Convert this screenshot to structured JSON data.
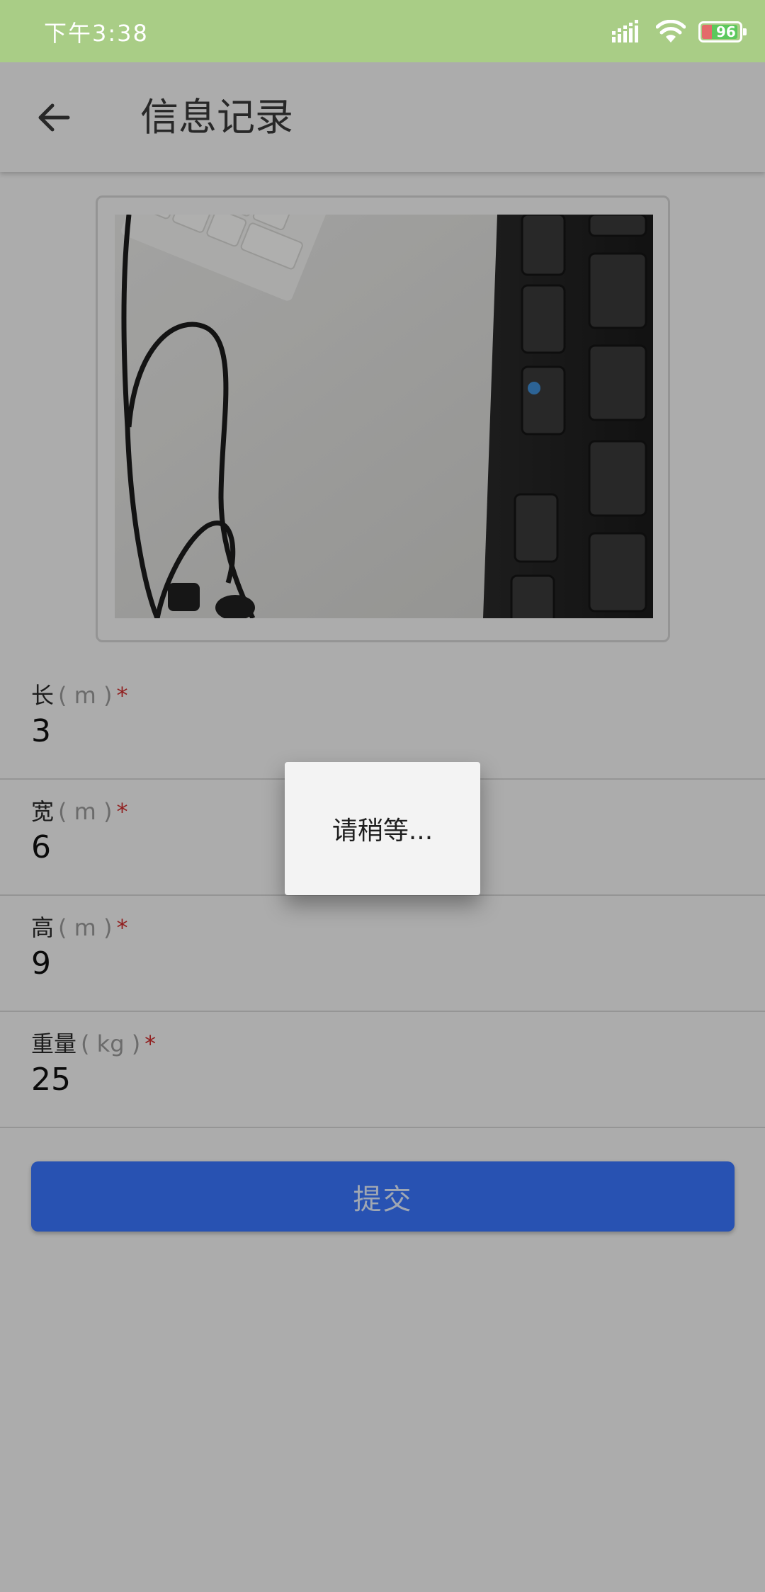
{
  "status_bar": {
    "time": "下午3:38",
    "signal_icon": "signal-icon",
    "wifi_icon": "wifi-icon",
    "battery_level": "96",
    "battery_fraction": 0.96,
    "color": "#a9cd86"
  },
  "app_bar": {
    "back_icon": "arrow-left-icon",
    "title": "信息记录"
  },
  "photo": {
    "content": "photo-thumbnail"
  },
  "form": {
    "fields": [
      {
        "label": "长",
        "unit": "( m )",
        "required": "*",
        "value": "3"
      },
      {
        "label": "宽",
        "unit": "( m )",
        "required": "*",
        "value": "6"
      },
      {
        "label": "高",
        "unit": "( m )",
        "required": "*",
        "value": "9"
      },
      {
        "label": "重量",
        "unit": "( kg )",
        "required": "*",
        "value": "25"
      }
    ]
  },
  "submit": {
    "label": "提交",
    "color": "#3a76ff"
  },
  "dialog": {
    "text": "请稍等..."
  }
}
